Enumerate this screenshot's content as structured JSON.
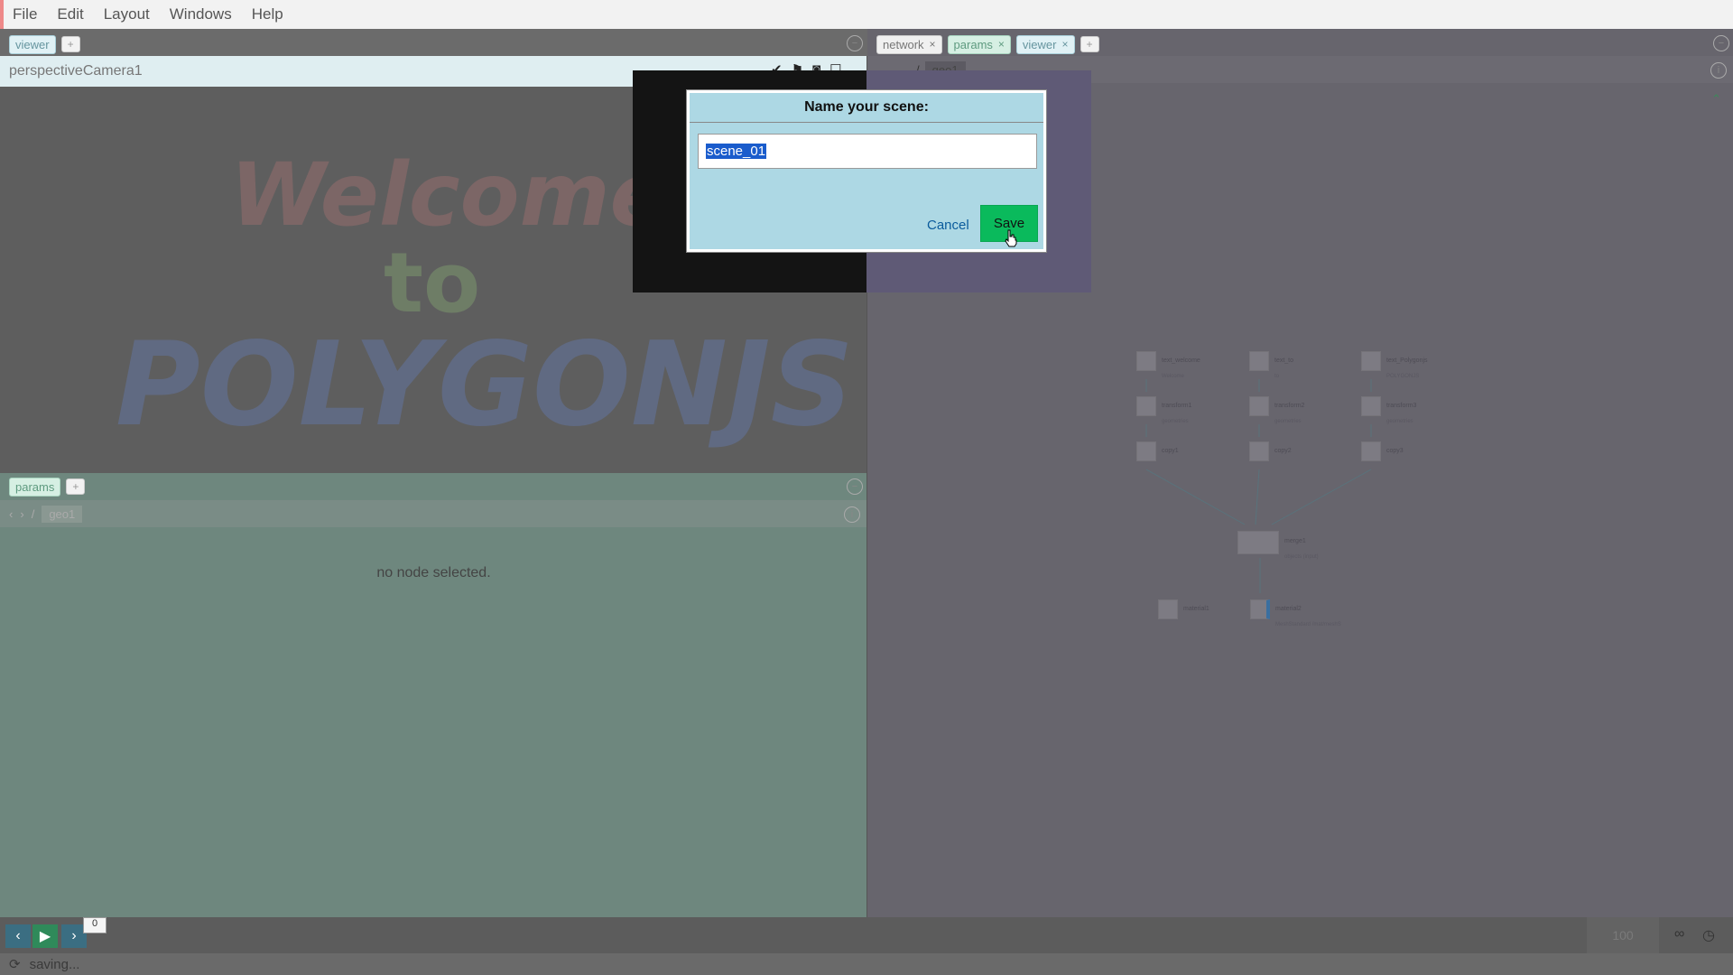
{
  "menu": {
    "items": [
      "File",
      "Edit",
      "Layout",
      "Windows",
      "Help"
    ]
  },
  "viewer_panel": {
    "tab": "viewer",
    "camera": "perspectiveCamera1",
    "welcome": [
      "Welcome",
      "to",
      "POLYGONJS"
    ]
  },
  "params_panel": {
    "tab": "params",
    "path_sep": "/",
    "crumb": "geo1",
    "empty_message": "no node selected."
  },
  "network_panel": {
    "tabs": [
      "network",
      "params",
      "viewer"
    ],
    "path_sep": "/",
    "crumb": "geo1",
    "nodes": [
      {
        "label": "text_welcome",
        "sub": "Welcome"
      },
      {
        "label": "text_to",
        "sub": "to"
      },
      {
        "label": "text_Polygonjs",
        "sub": "POLYGONJS"
      },
      {
        "label": "transform1",
        "sub": "geometries"
      },
      {
        "label": "transform2",
        "sub": "geometries"
      },
      {
        "label": "transform3",
        "sub": "geometries"
      },
      {
        "label": "copy1",
        "sub": ""
      },
      {
        "label": "copy2",
        "sub": ""
      },
      {
        "label": "copy3",
        "sub": ""
      },
      {
        "label": "merge1",
        "sub": "objects (input)"
      },
      {
        "label": "material1",
        "sub": ""
      },
      {
        "label": "material2",
        "sub": "MeshStandard /mat/meshS"
      }
    ]
  },
  "timeline": {
    "current_frame": "0",
    "end_frame": "100"
  },
  "status": {
    "text": "saving..."
  },
  "dialog": {
    "title": "Name your scene:",
    "input_value": "scene_01",
    "cancel_label": "Cancel",
    "save_label": "Save"
  },
  "colors": {
    "save": "#0aba5c",
    "dialog_bg": "#add8e4",
    "selection": "#1a5ccc"
  }
}
